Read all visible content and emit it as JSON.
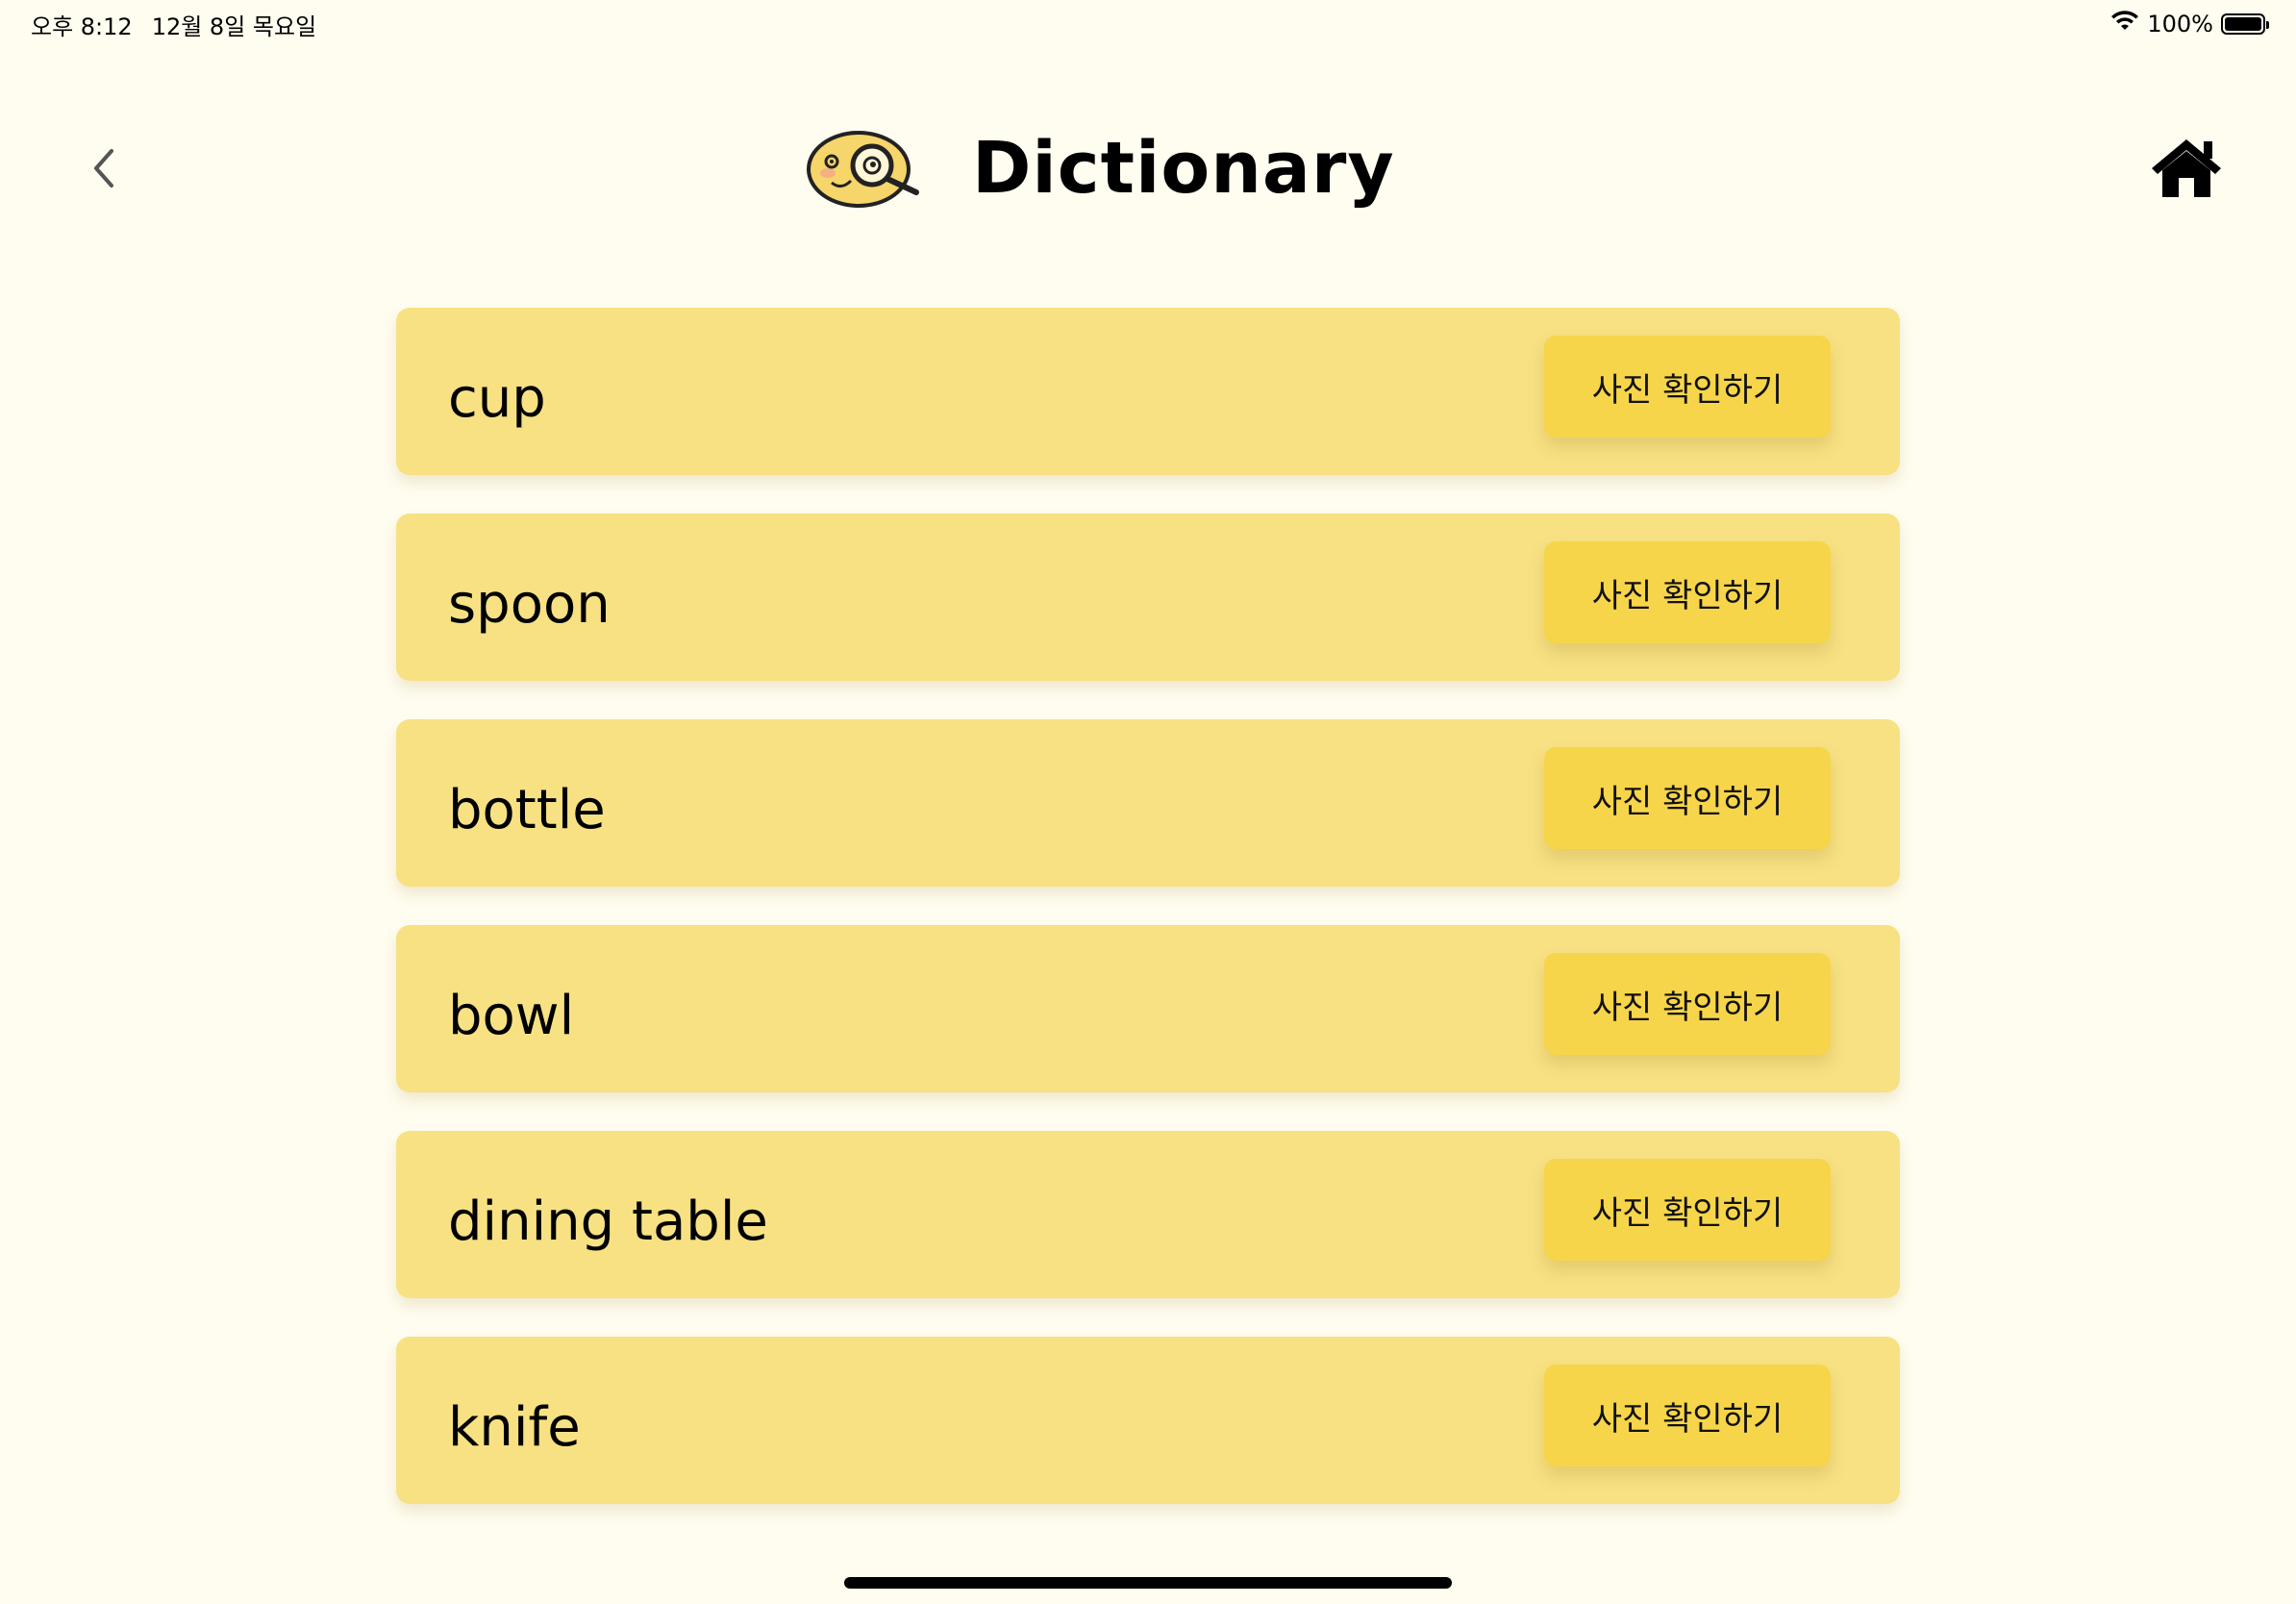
{
  "status_bar": {
    "time": "오후 8:12",
    "date": "12월 8일 목요일",
    "battery_text": "100%",
    "battery_level": 1.0,
    "wifi_icon": "wifi-icon",
    "battery_icon": "battery-icon"
  },
  "header": {
    "title": "Dictionary",
    "back_icon": "chevron-left-icon",
    "home_icon": "home-icon",
    "mascot_icon": "magnifier-mascot-icon"
  },
  "words": [
    {
      "word": "cup",
      "button_label": "사진 확인하기"
    },
    {
      "word": "spoon",
      "button_label": "사진 확인하기"
    },
    {
      "word": "bottle",
      "button_label": "사진 확인하기"
    },
    {
      "word": "bowl",
      "button_label": "사진 확인하기"
    },
    {
      "word": "dining table",
      "button_label": "사진 확인하기"
    },
    {
      "word": "knife",
      "button_label": "사진 확인하기"
    }
  ],
  "colors": {
    "background": "#fffdf0",
    "card": "#f7e183",
    "button": "#f7d54a"
  }
}
